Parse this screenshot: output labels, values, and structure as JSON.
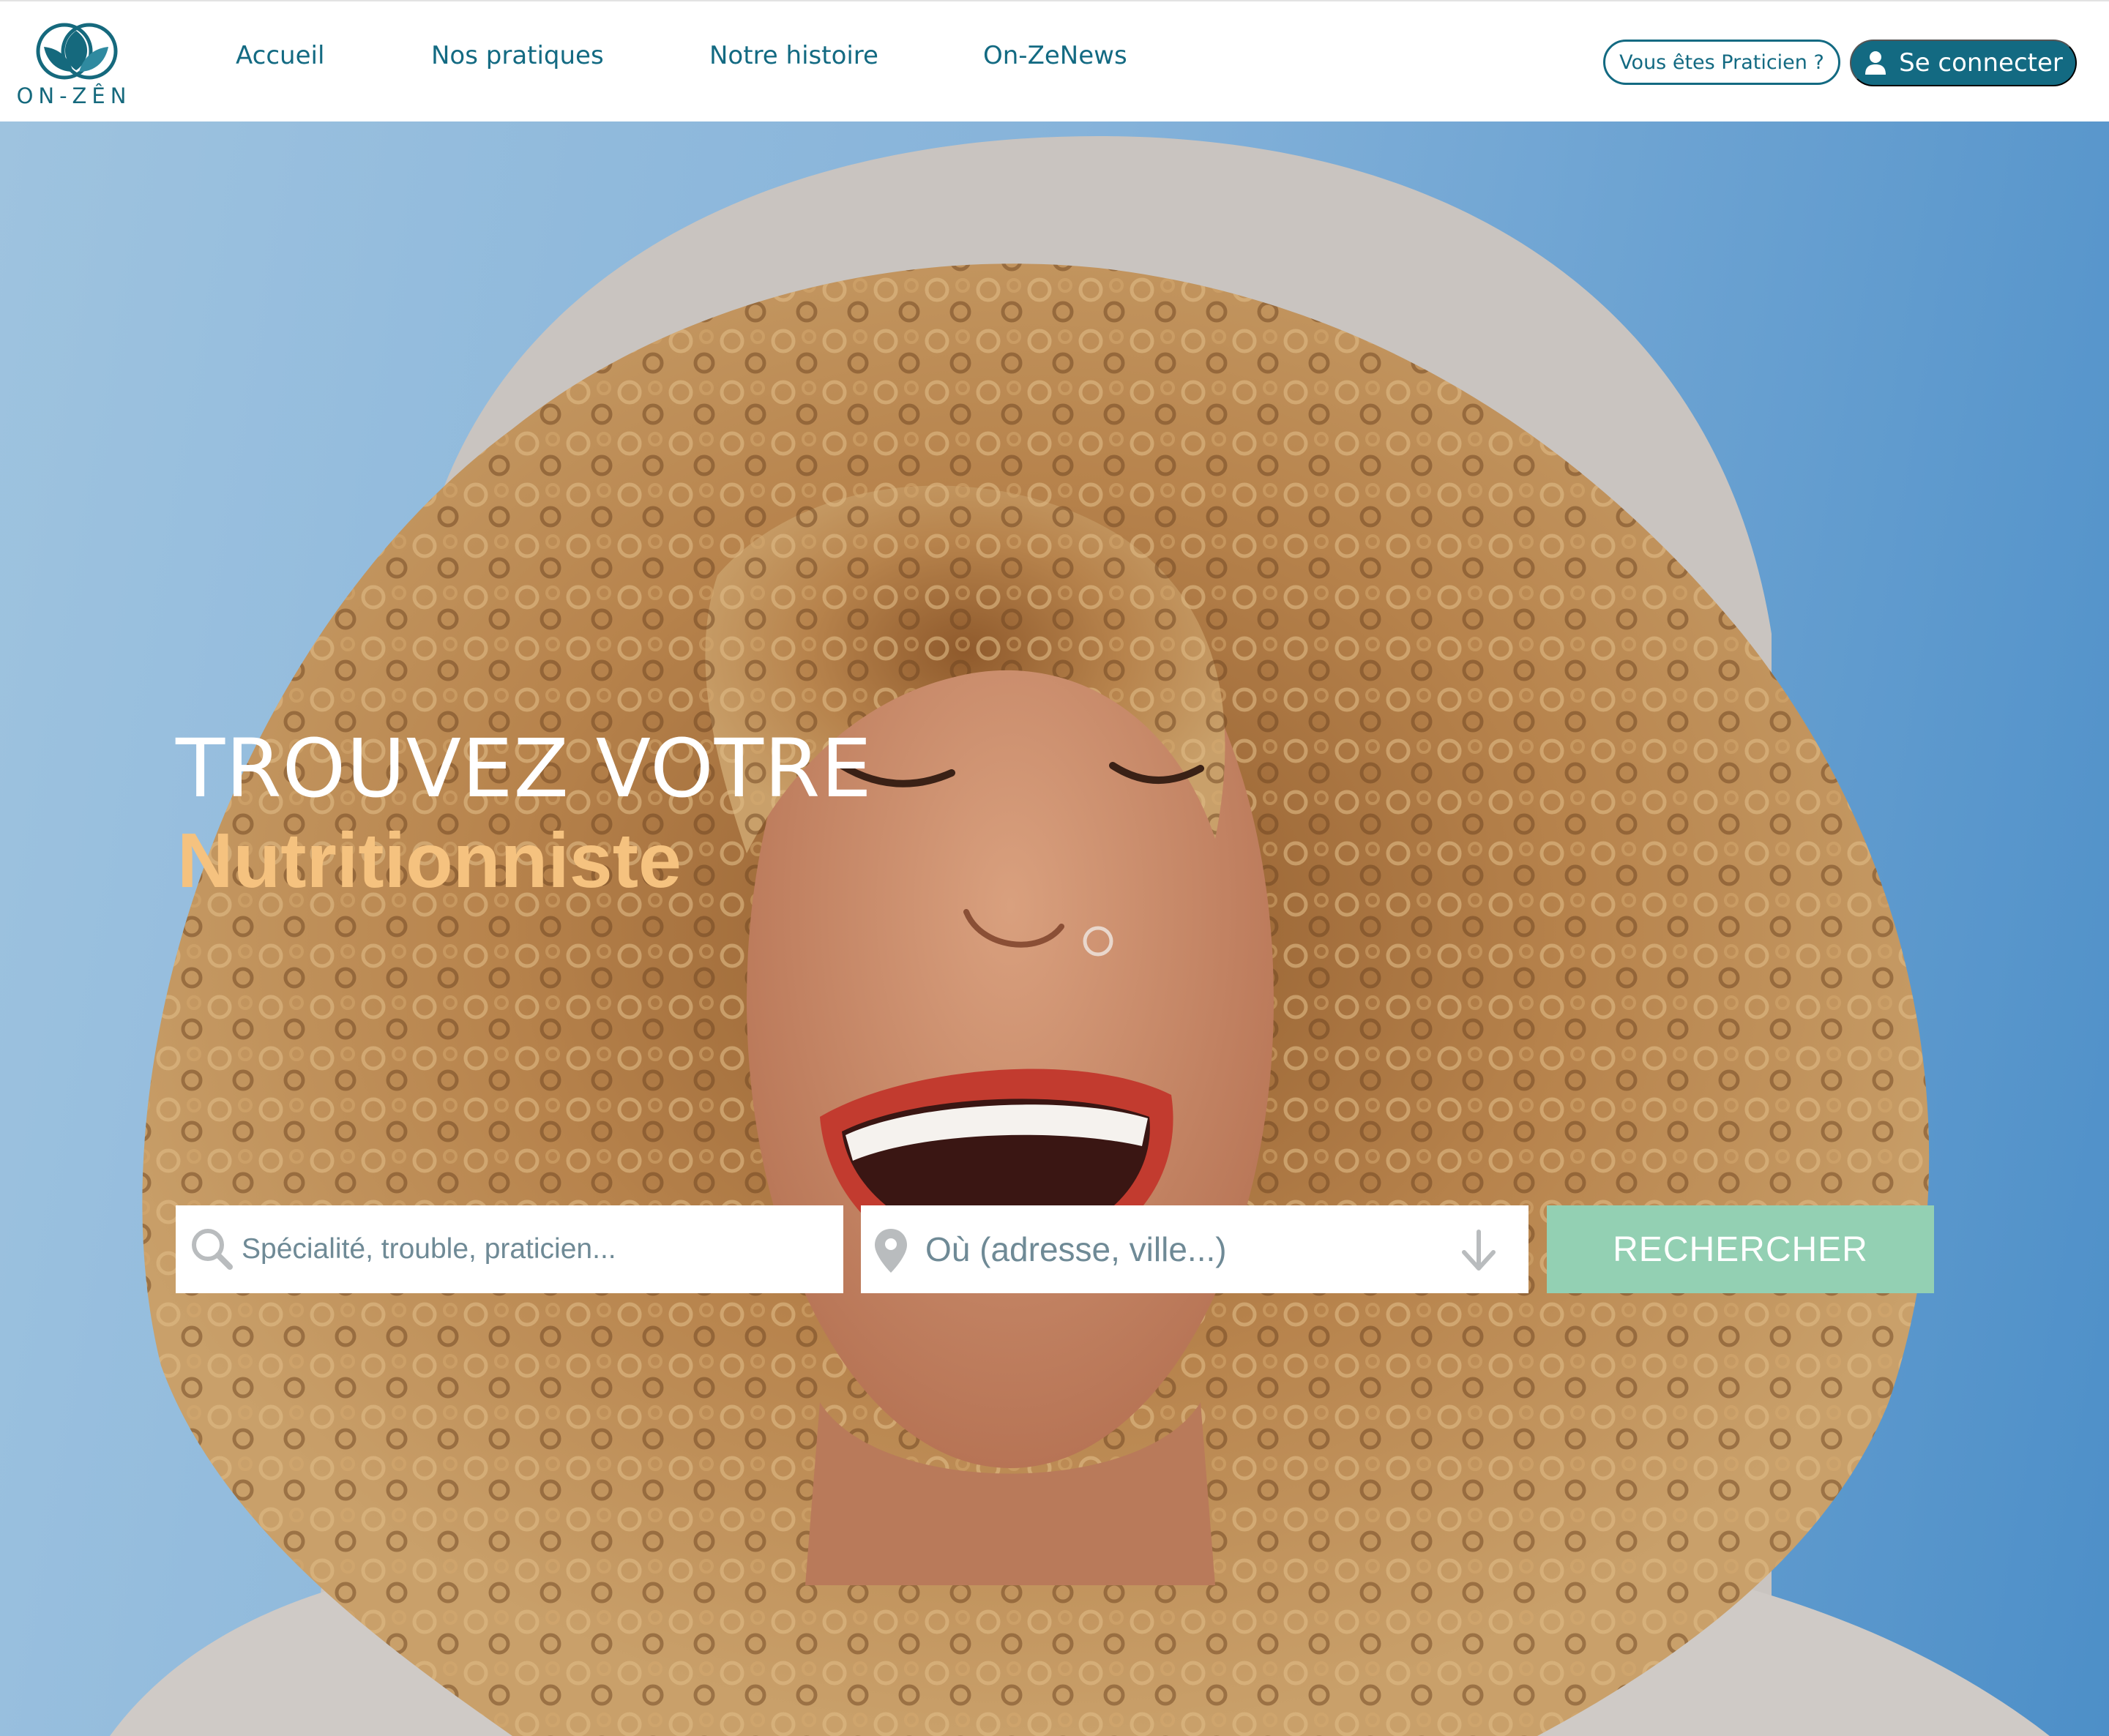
{
  "header": {
    "logo_text": "ON-ZÊN",
    "nav": [
      {
        "label": "Accueil"
      },
      {
        "label": "Nos pratiques"
      },
      {
        "label": "Notre histoire"
      },
      {
        "label": "On-ZeNews"
      }
    ],
    "practitioner_button": "Vous êtes Praticien ?",
    "login_button": "Se connecter"
  },
  "hero": {
    "title": "TROUVEZ VOTRE",
    "subtitle": "Nutritionniste",
    "search": {
      "query_placeholder": "Spécialité, trouble, praticien...",
      "location_placeholder": "Où (adresse, ville...)",
      "button_label": "RECHERCHER"
    }
  },
  "colors": {
    "brand_teal": "#136a82",
    "accent_orange": "#f5c27f",
    "search_button_green": "#93d0b3",
    "hero_sky_blue": "#86b3da"
  },
  "icons": [
    "lotus-logo-icon",
    "user-icon",
    "search-icon",
    "location-pin-icon",
    "arrow-down-icon"
  ]
}
